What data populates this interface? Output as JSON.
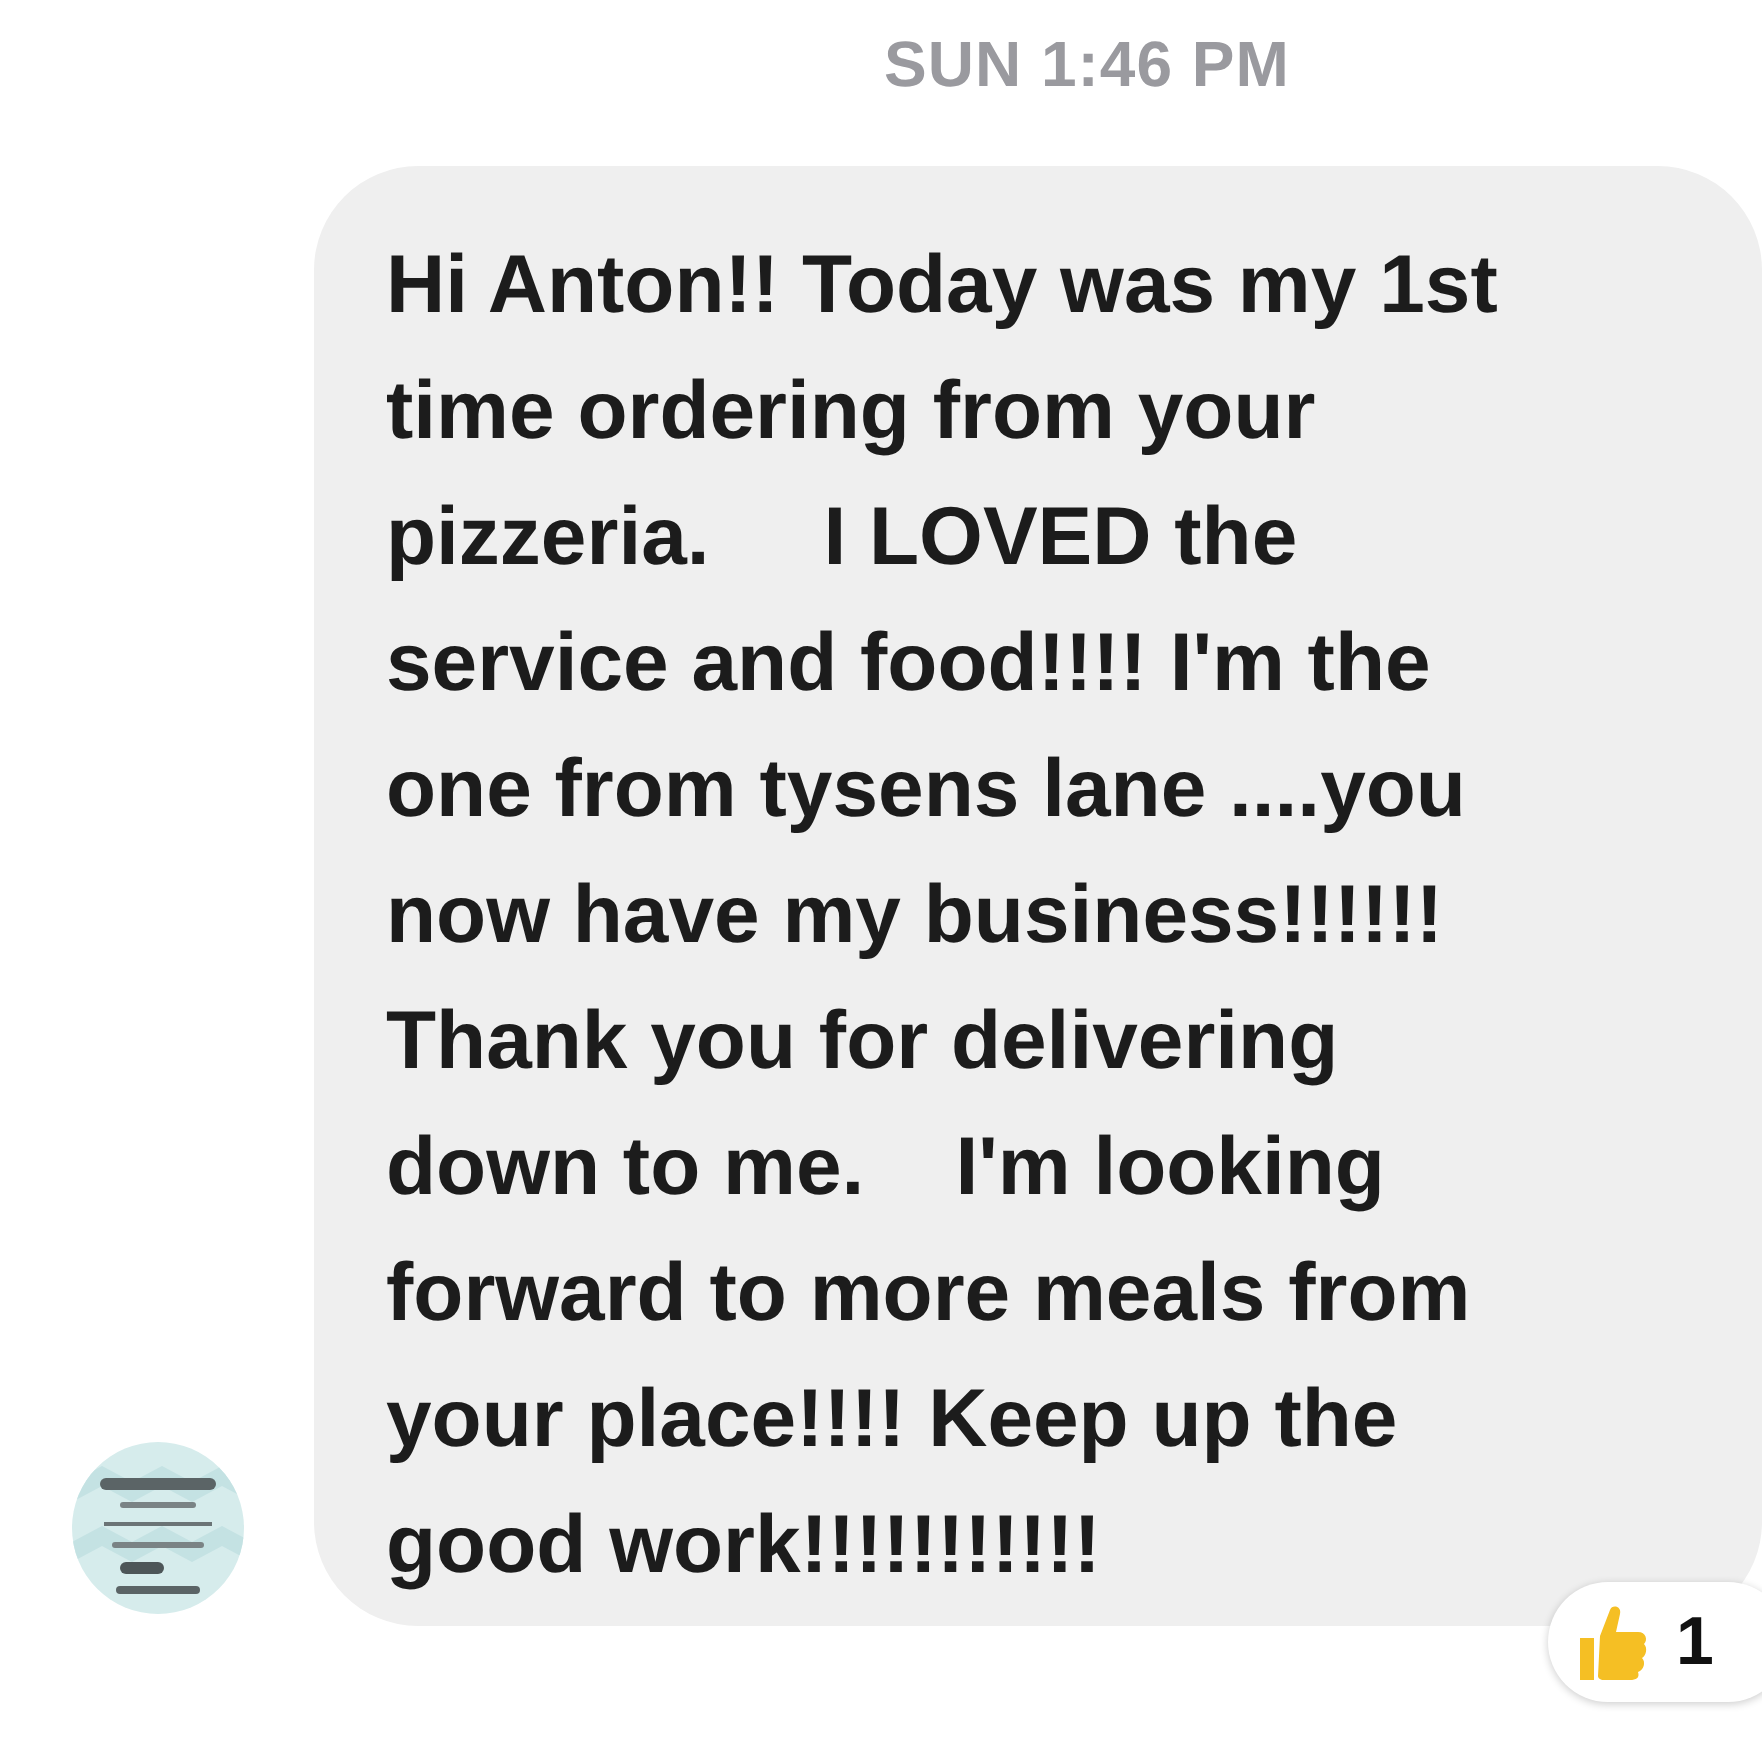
{
  "timestamp": "SUN 1:46 PM",
  "message": {
    "lines": [
      "Hi Anton!! Today was my 1st",
      "time ordering from your",
      "pizzeria.     I LOVED the",
      "service and food!!!! I'm the",
      "one from tysens lane ....you",
      "now have my business!!!!!!",
      "Thank you for delivering",
      "down to me.    I'm looking",
      "forward to more meals from",
      "your place!!!! Keep up the",
      "good work!!!!!!!!!!!"
    ],
    "reaction": {
      "count": "1"
    }
  }
}
